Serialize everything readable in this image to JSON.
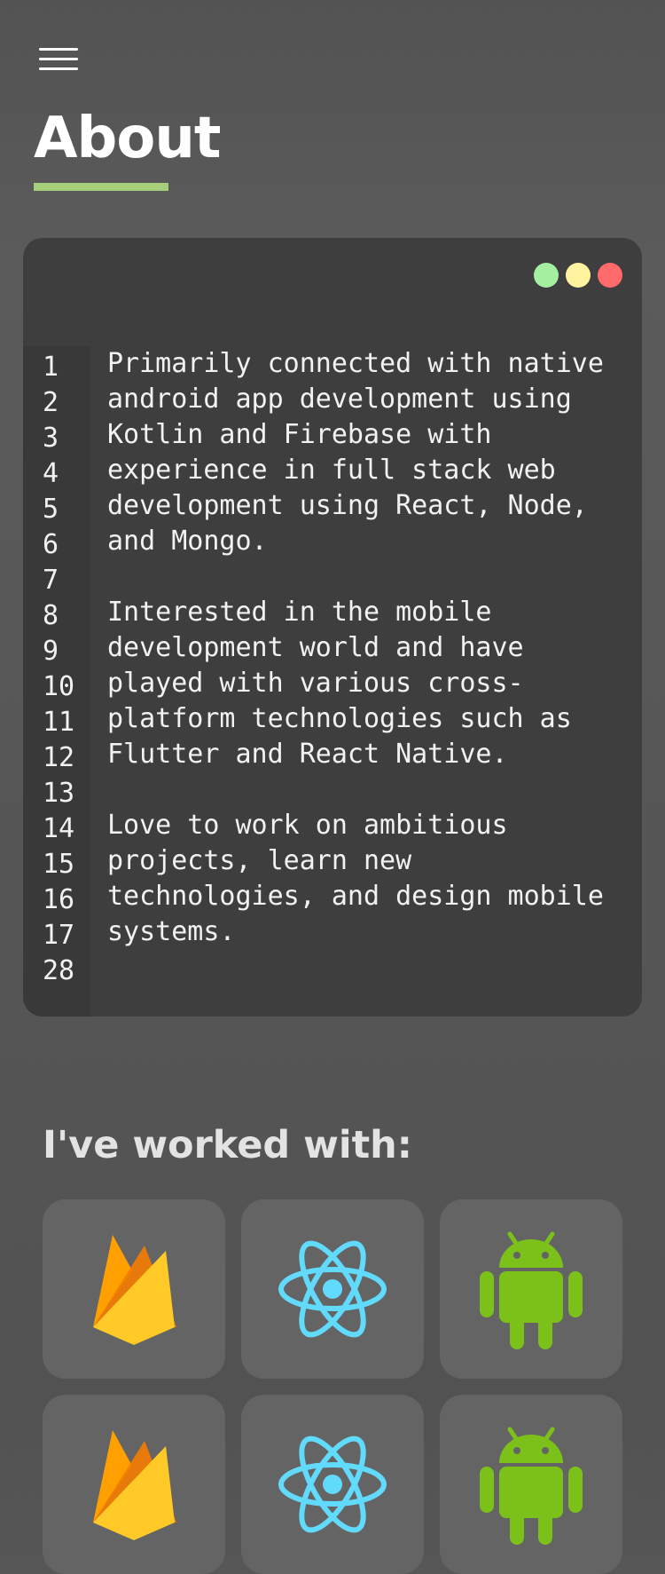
{
  "header": {
    "title": "About"
  },
  "editor": {
    "lines": [
      {
        "n": "1",
        "text": "Primarily connected with native"
      },
      {
        "n": "2",
        "text": "android app development using"
      },
      {
        "n": "3",
        "text": "Kotlin and Firebase with"
      },
      {
        "n": "4",
        "text": "experience in full stack web"
      },
      {
        "n": "5",
        "text": "development using React, Node,"
      },
      {
        "n": "6",
        "text": "and Mongo."
      },
      {
        "n": "7",
        "text": ""
      },
      {
        "n": "8",
        "text": "Interested in the mobile"
      },
      {
        "n": "9",
        "text": "development world and have"
      },
      {
        "n": "10",
        "text": "played with various cross-"
      },
      {
        "n": "11",
        "text": "platform technologies such as"
      },
      {
        "n": "12",
        "text": "Flutter and React Native."
      },
      {
        "n": "13",
        "text": ""
      },
      {
        "n": "14",
        "text": "Love to work on ambitious"
      },
      {
        "n": "15",
        "text": "projects, learn new"
      },
      {
        "n": "16",
        "text": "technologies, and design mobile"
      },
      {
        "n": "17",
        "text": "systems."
      },
      {
        "n": "28",
        "text": ""
      }
    ]
  },
  "skills": {
    "title": "I've worked with:",
    "items": [
      "firebase-icon",
      "react-icon",
      "android-icon",
      "firebase-icon",
      "react-icon",
      "android-icon"
    ]
  },
  "colors": {
    "accent": "#a5cf78",
    "dot_green": "#a4f0a0",
    "dot_yellow": "#fff3a0",
    "dot_red": "#ff6b6b"
  }
}
